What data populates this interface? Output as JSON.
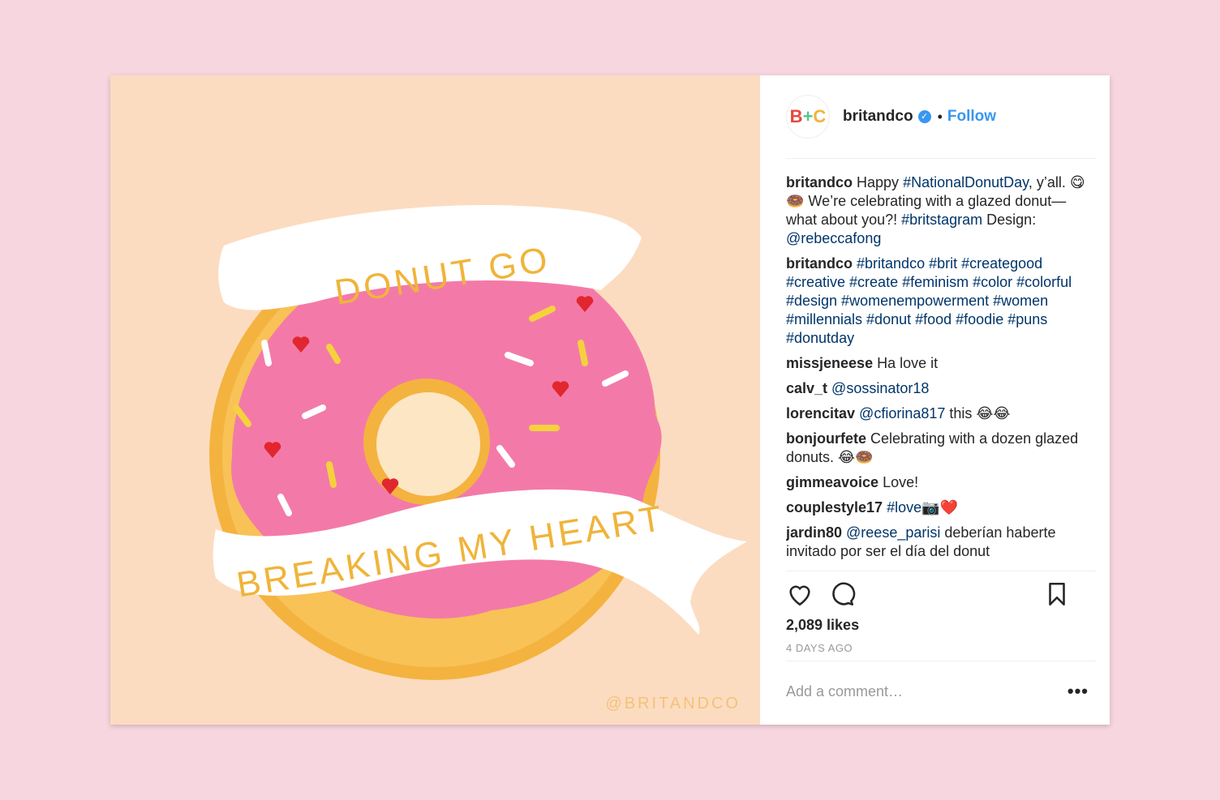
{
  "post": {
    "image": {
      "banner_top": "DONUT GO",
      "banner_bottom": "BREAKING MY HEART",
      "watermark": "@BRITANDCO",
      "colors": {
        "background": "#fcdcc0",
        "dough": "#f4b33f",
        "icing": "#f37aa8",
        "ribbon": "#ffffff",
        "lettering": "#f0b43a"
      }
    },
    "header": {
      "avatar_text": {
        "b": "B",
        "plus": "+",
        "c": "C"
      },
      "username": "britandco",
      "verified_icon": "verified-badge-icon",
      "separator": "•",
      "follow_label": "Follow"
    },
    "comments": [
      {
        "user": "britandco",
        "parts": [
          {
            "text": "Happy ",
            "type": "text"
          },
          {
            "text": "#NationalDonutDay",
            "type": "tag"
          },
          {
            "text": ", y’all. 😋🍩 We’re celebrating with a glazed donut—what about you?! ",
            "type": "text"
          },
          {
            "text": "#britstagram",
            "type": "tag"
          },
          {
            "text": " Design: ",
            "type": "text"
          },
          {
            "text": "@rebeccafong",
            "type": "tag"
          }
        ]
      },
      {
        "user": "britandco",
        "parts": [
          {
            "text": "#britandco #brit #creategood #creative #create #feminism #color #colorful #design #womenempowerment #women #millennials #donut #food #foodie #puns #donutday",
            "type": "tag"
          }
        ]
      },
      {
        "user": "missjeneese",
        "parts": [
          {
            "text": "Ha love it",
            "type": "text"
          }
        ]
      },
      {
        "user": "calv_t",
        "parts": [
          {
            "text": "@sossinator18",
            "type": "tag"
          }
        ]
      },
      {
        "user": "lorencitav",
        "parts": [
          {
            "text": "@cfiorina817",
            "type": "tag"
          },
          {
            "text": " this 😂😂",
            "type": "text"
          }
        ]
      },
      {
        "user": "bonjourfete",
        "parts": [
          {
            "text": "Celebrating with a dozen glazed donuts. 😂🍩",
            "type": "text"
          }
        ]
      },
      {
        "user": "gimmeavoice",
        "parts": [
          {
            "text": "Love!",
            "type": "text"
          }
        ]
      },
      {
        "user": "couplestyle17",
        "parts": [
          {
            "text": "#love",
            "type": "tag"
          },
          {
            "text": "📷❤️",
            "type": "text"
          }
        ]
      },
      {
        "user": "jardin80",
        "parts": [
          {
            "text": "@reese_parisi",
            "type": "tag"
          },
          {
            "text": " deberían haberte invitado por ser el día del donut",
            "type": "text"
          }
        ]
      }
    ],
    "actions": {
      "like_icon": "heart-icon",
      "comment_icon": "comment-bubble-icon",
      "save_icon": "bookmark-icon"
    },
    "likes": "2,089 likes",
    "timestamp": "4 DAYS AGO",
    "add_comment_placeholder": "Add a comment…",
    "more_label": "•••"
  }
}
